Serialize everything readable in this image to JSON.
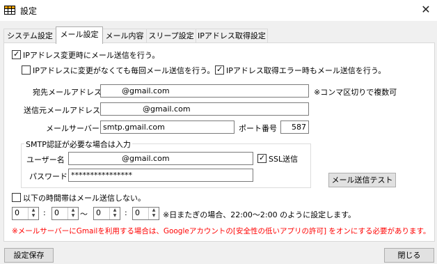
{
  "window": {
    "title": "設定",
    "app_icon": "grid-app-icon",
    "close_icon": "close-icon"
  },
  "tabs": [
    {
      "label": "システム設定",
      "active": false
    },
    {
      "label": "メール設定",
      "active": true
    },
    {
      "label": "メール内容",
      "active": false
    },
    {
      "label": "スリープ設定",
      "active": false
    },
    {
      "label": "IPアドレス取得設定",
      "active": false
    }
  ],
  "mail": {
    "notify_on_ip_change": {
      "label": "IPアドレス変更時にメール送信を行う。",
      "checked": true
    },
    "always_send": {
      "label": "IPアドレスに変更がなくても毎回メール送信を行う。",
      "checked": false
    },
    "send_on_error": {
      "label": "IPアドレス取得エラー時もメール送信を行う。",
      "checked": true
    },
    "to_label": "宛先メールアドレス",
    "to_value": "@gmail.com",
    "to_note": "※コンマ区切りで複数可",
    "from_label": "送信元メールアドレス",
    "from_value": "@gmail.com",
    "server_label": "メールサーバー",
    "server_value": "smtp.gmail.com",
    "port_label": "ポート番号",
    "port_value": "587",
    "smtp_group_title": "SMTP認証が必要な場合は入力",
    "user_label": "ユーザー名",
    "user_value": "@gmail.com",
    "ssl": {
      "label": "SSL送信",
      "checked": true
    },
    "password_label": "パスワード",
    "password_value": "****************",
    "test_button": "メール送信テスト",
    "quiet_hours": {
      "label": "以下の時間帯はメール送信しない。",
      "checked": false
    },
    "time": {
      "start_hour": "0",
      "start_min": "0",
      "end_hour": "0",
      "end_min": "0",
      "colon": ":",
      "tilde": "～",
      "note": "※日またぎの場合、22:00～2:00 のように設定します。"
    },
    "warning": "※メールサーバーにGmailを利用する場合は、Googleアカウントの[安全性の低いアプリの許可] をオンにする必要があります。"
  },
  "footer": {
    "save_label": "設定保存",
    "close_label": "閉じる"
  },
  "colors": {
    "warning": "#ff0000",
    "panel": "#ffffff",
    "window": "#f0f0f0"
  }
}
